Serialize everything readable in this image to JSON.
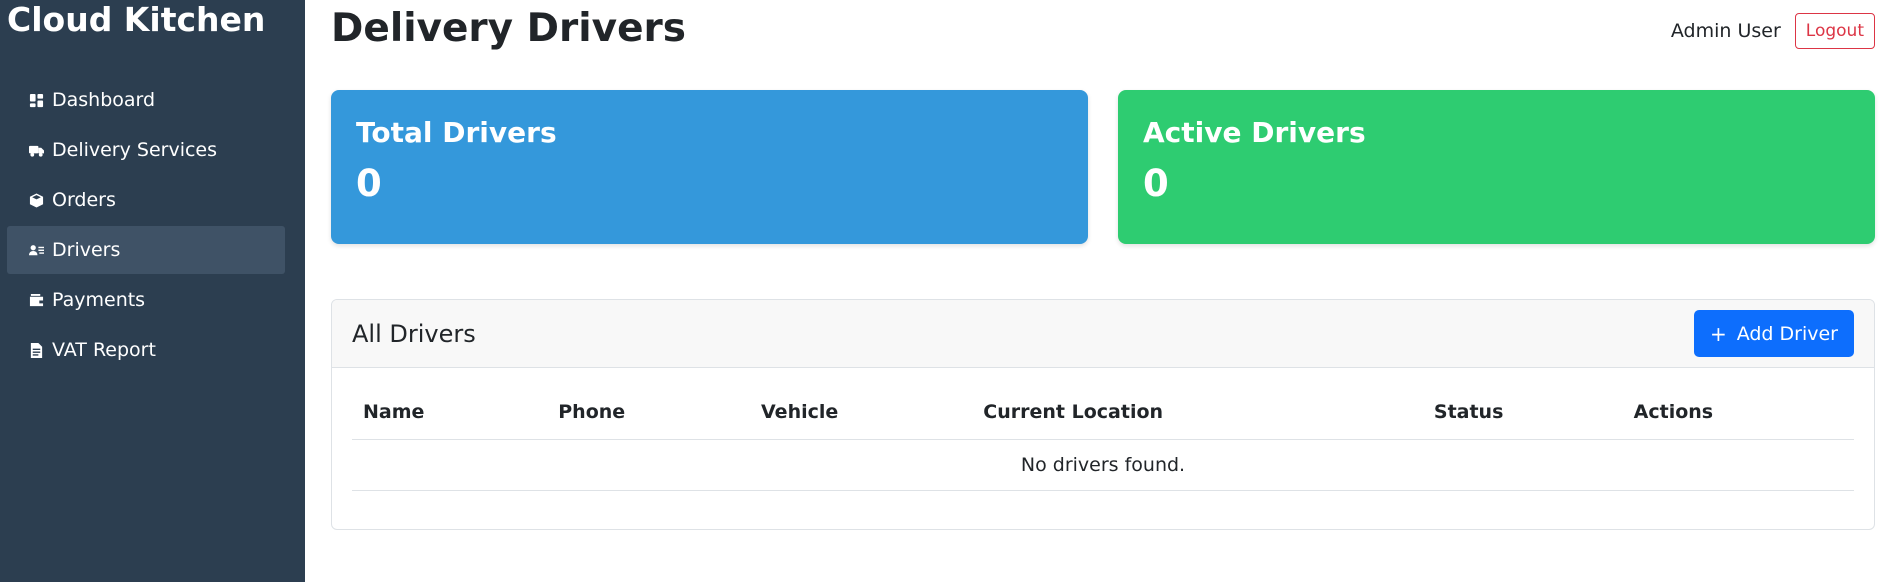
{
  "app": {
    "brand": "Cloud Kitchen"
  },
  "sidebar": {
    "items": [
      {
        "label": "Dashboard",
        "icon": "dashboard-icon",
        "active": false
      },
      {
        "label": "Delivery Services",
        "icon": "truck-icon",
        "active": false
      },
      {
        "label": "Orders",
        "icon": "box-icon",
        "active": false
      },
      {
        "label": "Drivers",
        "icon": "person-badge-icon",
        "active": true
      },
      {
        "label": "Payments",
        "icon": "wallet-icon",
        "active": false
      },
      {
        "label": "VAT Report",
        "icon": "document-icon",
        "active": false
      }
    ]
  },
  "header": {
    "title": "Delivery Drivers",
    "user_name": "Admin User",
    "logout_label": "Logout"
  },
  "stats": {
    "total": {
      "label": "Total Drivers",
      "value": "0",
      "color": "#3498db"
    },
    "active": {
      "label": "Active Drivers",
      "value": "0",
      "color": "#2ecc71"
    }
  },
  "drivers_panel": {
    "title": "All Drivers",
    "add_label": "Add Driver",
    "columns": [
      "Name",
      "Phone",
      "Vehicle",
      "Current Location",
      "Status",
      "Actions"
    ],
    "empty_text": "No drivers found."
  },
  "colors": {
    "sidebar_bg": "#2c3e50",
    "sidebar_active": "#3f5266",
    "primary": "#0d6efd",
    "danger": "#dc3545"
  }
}
